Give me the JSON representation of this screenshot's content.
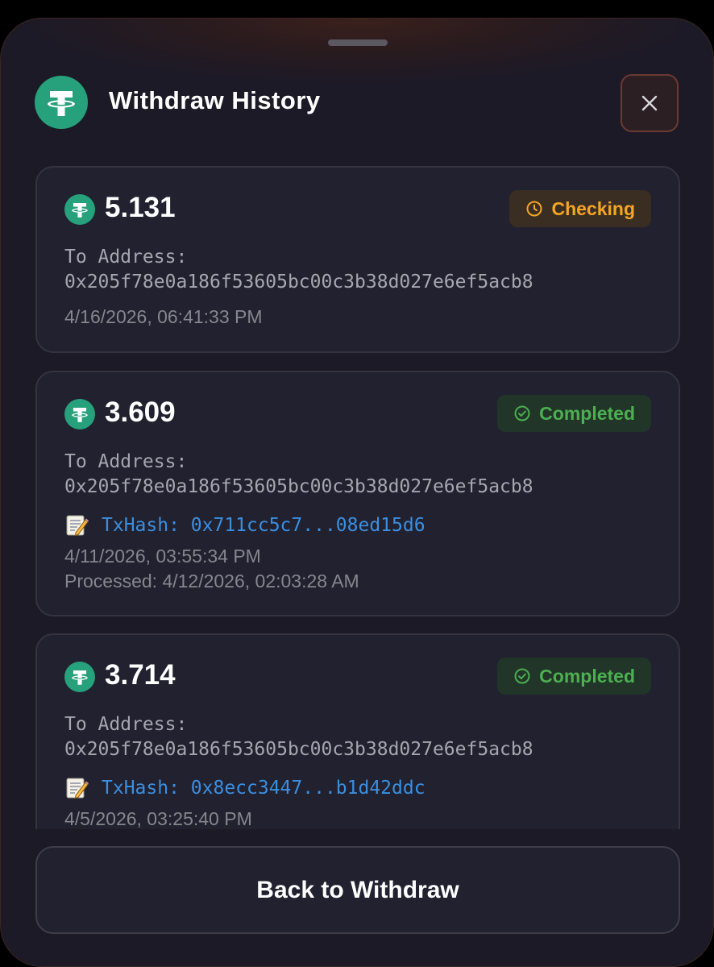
{
  "header": {
    "title": "Withdraw History",
    "close_icon": "close-icon",
    "logo_icon": "tether-logo-icon"
  },
  "colors": {
    "tether_green": "#26a17b",
    "checking": "#f5a623",
    "completed": "#4caf50",
    "txhash_link": "#3b8fe0"
  },
  "withdrawals": [
    {
      "amount": "5.131",
      "status": "Checking",
      "status_icon": "clock-icon",
      "to_label": "To Address:",
      "address": "0x205f78e0a186f53605bc00c3b38d027e6ef5acb8",
      "date": "4/16/2026, 06:41:33 PM"
    },
    {
      "amount": "3.609",
      "status": "Completed",
      "status_icon": "check-circle-icon",
      "to_label": "To Address:",
      "address": "0x205f78e0a186f53605bc00c3b38d027e6ef5acb8",
      "txhash": "TxHash: 0x711cc5c7...08ed15d6",
      "date": "4/11/2026, 03:55:34 PM",
      "processed": "Processed: 4/12/2026, 02:03:28 AM"
    },
    {
      "amount": "3.714",
      "status": "Completed",
      "status_icon": "check-circle-icon",
      "to_label": "To Address:",
      "address": "0x205f78e0a186f53605bc00c3b38d027e6ef5acb8",
      "txhash": "TxHash: 0x8ecc3447...b1d42ddc",
      "date": "4/5/2026, 03:25:40 PM"
    }
  ],
  "footer": {
    "back_label": "Back to Withdraw"
  }
}
